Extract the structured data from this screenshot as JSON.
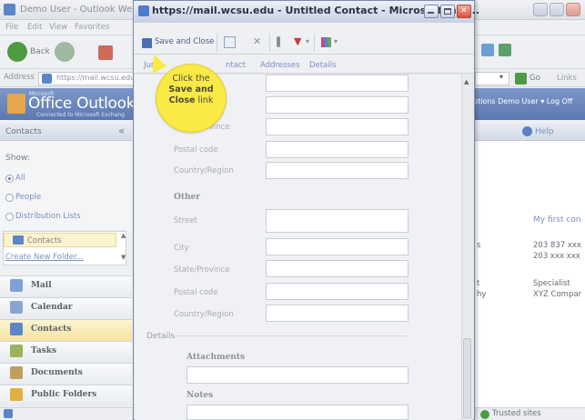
{
  "background": {
    "window_title": "Demo User - Outlook We",
    "menu": [
      "File",
      "Edit",
      "View",
      "Favorites"
    ],
    "back_label": "Back",
    "address_label": "Address",
    "address_value": "https://mail.wcsu.edu",
    "owa_small": "Microsoft",
    "owa_logo": "Office Outlook We",
    "owa_sub": "Connected to Microsoft Exchang",
    "go_label": "Go",
    "links_label": "Links",
    "options_bar": "ptions  Demo User ▾  Log Off"
  },
  "nav": {
    "header": "Contacts",
    "collapse_glyph": "«",
    "show_label": "Show:",
    "options": [
      {
        "label": "All",
        "selected": true
      },
      {
        "label": "People",
        "selected": false
      },
      {
        "label": "Distribution Lists",
        "selected": false
      }
    ],
    "folder": "Contacts",
    "create_folder": "Create New Folder...",
    "buttons": [
      {
        "label": "Mail",
        "active": false,
        "color": "#7fa2d4"
      },
      {
        "label": "Calendar",
        "active": false,
        "color": "#8aa6d0"
      },
      {
        "label": "Contacts",
        "active": true,
        "color": "#5d86c8"
      },
      {
        "label": "Tasks",
        "active": false,
        "color": "#9bb35c"
      },
      {
        "label": "Documents",
        "active": false,
        "color": "#c0a060"
      },
      {
        "label": "Public Folders",
        "active": false,
        "color": "#e0b040"
      }
    ]
  },
  "right_panel": {
    "help": "Help",
    "preview_title": "My first con",
    "phone1": "203 837 xxx",
    "phone2": "203 xxx xxx",
    "job": "Specialist",
    "company": "XYZ Compar",
    "frag1": "s",
    "frag2": "t",
    "frag3": "hy",
    "status": "Trusted sites"
  },
  "popup": {
    "title": "https://mail.wcsu.edu - Untitled Contact - Microsoft Inte...",
    "save_close": "Save and Close",
    "tabs": [
      "Jump",
      "ntact",
      "Addresses",
      "Details"
    ],
    "fields_top": [
      "State/Province",
      "Postal code",
      "Country/Region"
    ],
    "other_section": "Other",
    "fields_other": [
      "Street",
      "City",
      "State/Province",
      "Postal code",
      "Country/Region"
    ],
    "details_section": "Details",
    "attachments": "Attachments",
    "notes": "Notes"
  },
  "callout": {
    "line1": "Click the",
    "line2": "Save and",
    "line3": "Close",
    "line4": "link"
  }
}
